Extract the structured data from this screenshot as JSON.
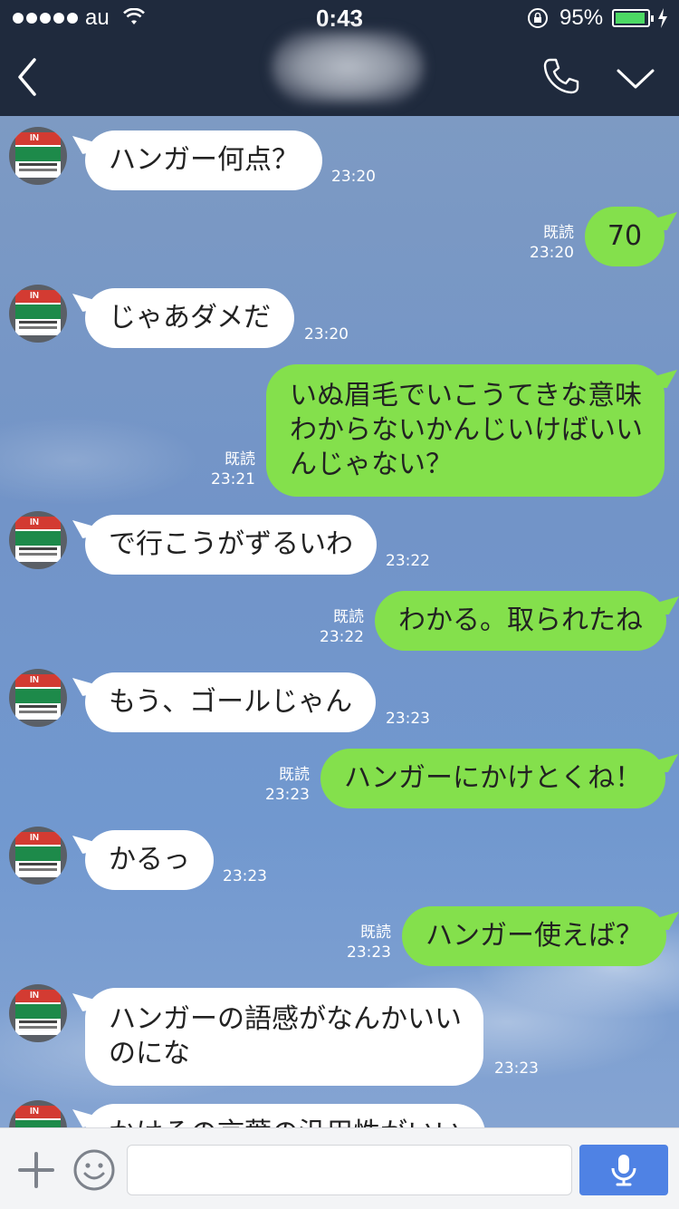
{
  "status": {
    "carrier": "au",
    "time": "0:43",
    "battery": "95%",
    "battery_level": 0.95,
    "colors": {
      "bar_bg": "#1f2a3d",
      "battery_fill": "#4cd964"
    }
  },
  "nav": {
    "back_icon": "chevron-left-icon",
    "call_icon": "phone-icon",
    "menu_icon": "chevron-down-icon"
  },
  "colors": {
    "incoming_bubble": "#ffffff",
    "outgoing_bubble": "#84e04c",
    "send_button": "#4f82e4"
  },
  "messages": [
    {
      "dir": "in",
      "text": "ハンガー何点？",
      "time": "23:20"
    },
    {
      "dir": "out",
      "text": "70",
      "read": "既読",
      "time": "23:20"
    },
    {
      "dir": "in",
      "text": "じゃあダメだ",
      "time": "23:20"
    },
    {
      "dir": "out",
      "lines": [
        "いぬ眉毛でいこうてきな意味",
        "わからないかんじいけばいい",
        "んじゃない？"
      ],
      "read": "既読",
      "time": "23:21"
    },
    {
      "dir": "in",
      "text": "で行こうがずるいわ",
      "time": "23:22"
    },
    {
      "dir": "out",
      "text": "わかる。取られたね",
      "read": "既読",
      "time": "23:22"
    },
    {
      "dir": "in",
      "text": "もう、ゴールじゃん",
      "time": "23:23"
    },
    {
      "dir": "out",
      "text": "ハンガーにかけとくね！",
      "read": "既読",
      "time": "23:23"
    },
    {
      "dir": "in",
      "text": "かるっ",
      "time": "23:23"
    },
    {
      "dir": "out",
      "text": "ハンガー使えば？",
      "read": "既読",
      "time": "23:23"
    },
    {
      "dir": "in",
      "lines": [
        "ハンガーの語感がなんかいい",
        "のにな"
      ],
      "time": "23:23"
    },
    {
      "dir": "in",
      "text": "かけその言葉の汎用性がいい",
      "time": ""
    }
  ],
  "input": {
    "value": "",
    "plus_icon": "plus-icon",
    "emoji_icon": "emoji-icon",
    "mic_icon": "microphone-icon"
  }
}
